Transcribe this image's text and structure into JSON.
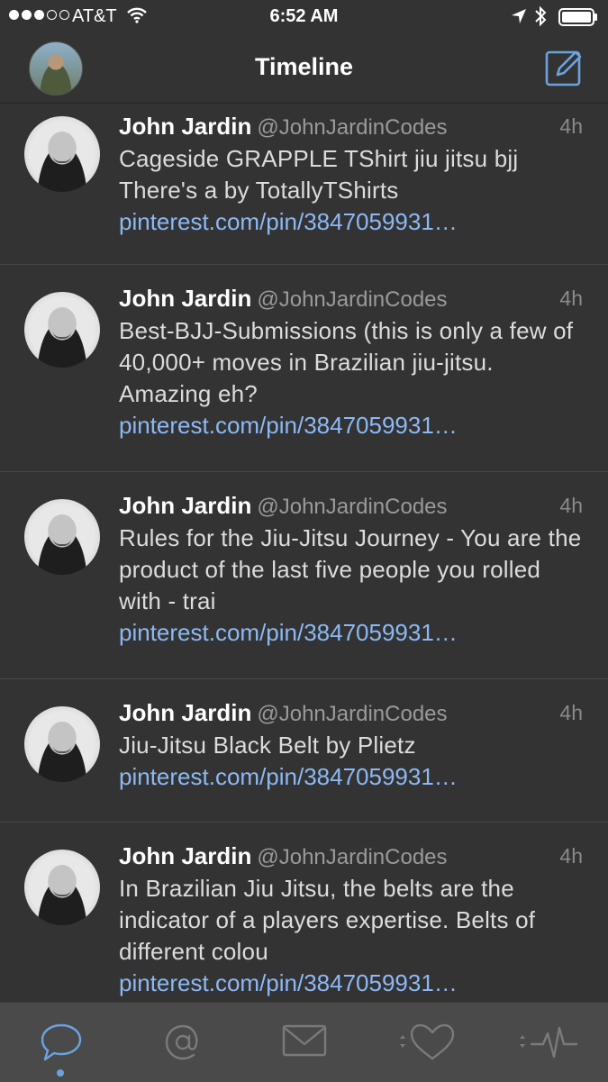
{
  "status_bar": {
    "carrier": "AT&T",
    "time": "6:52 AM",
    "signal_bars_filled": 3,
    "signal_bars_total": 5,
    "icons": [
      "wifi-icon",
      "location-icon",
      "bluetooth-icon",
      "battery-icon"
    ]
  },
  "nav": {
    "title": "Timeline",
    "icons": [
      "avatar",
      "compose-icon"
    ]
  },
  "tweets": [
    {
      "name": "John Jardin",
      "handle": "@JohnJardinCodes",
      "time": "4h",
      "text": "Cageside GRAPPLE TShirt jiu jitsu bjj There's a by TotallyTShirts",
      "link": "pinterest.com/pin/3847059931…"
    },
    {
      "name": "John Jardin",
      "handle": "@JohnJardinCodes",
      "time": "4h",
      "text": "Best-BJJ-Submissions (this is only a few of 40,000+ moves in Brazilian jiu-jitsu. Amazing eh?",
      "link": "pinterest.com/pin/3847059931…"
    },
    {
      "name": "John Jardin",
      "handle": "@JohnJardinCodes",
      "time": "4h",
      "text": "Rules for the Jiu-Jitsu Journey - You are the product of the last five people you rolled with - trai",
      "link": "pinterest.com/pin/3847059931…"
    },
    {
      "name": "John Jardin",
      "handle": "@JohnJardinCodes",
      "time": "4h",
      "text": "Jiu-Jitsu Black Belt by Plietz",
      "link": "pinterest.com/pin/3847059931…"
    },
    {
      "name": "John Jardin",
      "handle": "@JohnJardinCodes",
      "time": "4h",
      "text": "In Brazilian Jiu Jitsu, the belts are the indicator of a players expertise. Belts of different colou",
      "link": "pinterest.com/pin/3847059931…"
    }
  ],
  "tab_bar": {
    "tabs": [
      "timeline-tab",
      "mentions-tab",
      "messages-tab",
      "likes-tab",
      "activity-tab"
    ],
    "selected": "timeline-tab"
  },
  "colors": {
    "background": "#333333",
    "link": "#8cb9f5",
    "accent": "#6aa3e0",
    "tab_bar": "#4a4a4a"
  }
}
